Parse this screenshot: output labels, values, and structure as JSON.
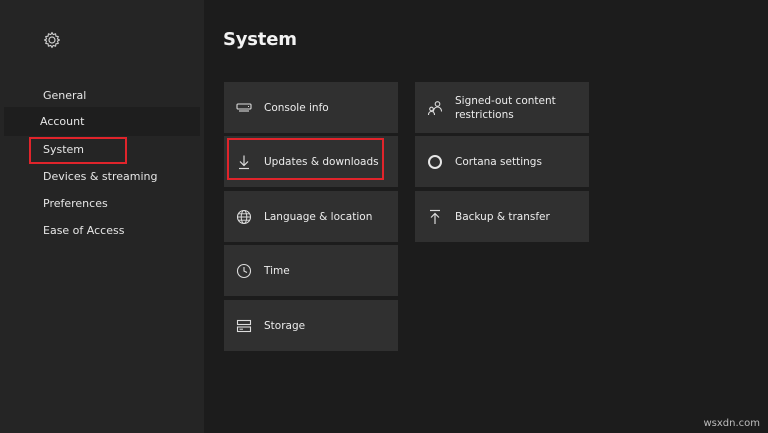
{
  "sidebar": {
    "settings_icon": "gear-icon",
    "items": [
      {
        "label": "General"
      },
      {
        "label": "Account"
      },
      {
        "label": "System"
      },
      {
        "label": "Devices & streaming"
      },
      {
        "label": "Preferences"
      },
      {
        "label": "Ease of Access"
      }
    ]
  },
  "main": {
    "title": "System",
    "tiles": [
      {
        "label": "Console info",
        "icon": "console-icon"
      },
      {
        "label": "Updates & downloads",
        "icon": "download-arrow-icon"
      },
      {
        "label": "Language & location",
        "icon": "globe-icon"
      },
      {
        "label": "Time",
        "icon": "clock-icon"
      },
      {
        "label": "Storage",
        "icon": "storage-icon"
      },
      {
        "label": "Signed-out content restrictions",
        "icon": "family-icon"
      },
      {
        "label": "Cortana settings",
        "icon": "cortana-circle-icon"
      },
      {
        "label": "Backup & transfer",
        "icon": "upload-arrow-icon"
      }
    ]
  },
  "watermark": "wsxdn.com",
  "colors": {
    "background": "#1c1c1c",
    "sidebar": "#252525",
    "tile": "#303030",
    "highlight": "#e0242b",
    "text": "#e8e8e8"
  }
}
